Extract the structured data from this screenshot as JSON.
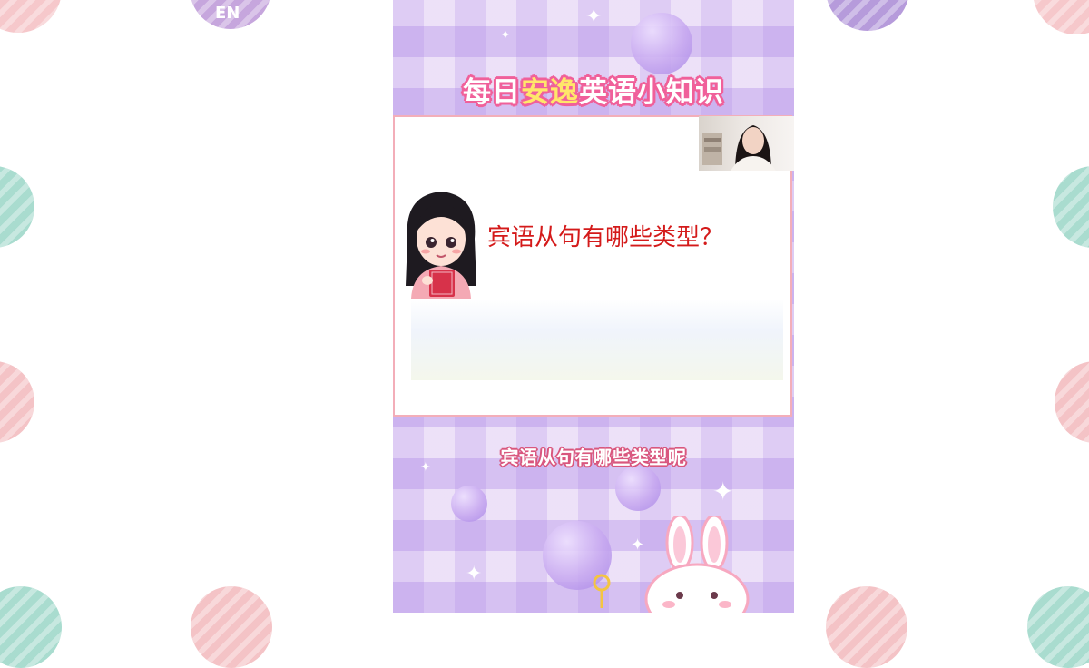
{
  "corner_badge": {
    "label": "EN"
  },
  "video": {
    "title_part1": "每日",
    "title_highlight": "安逸",
    "title_part2": "英语小知识",
    "slide_question": "宾语从句有哪些类型？",
    "caption": "宾语从句有哪些类型呢"
  },
  "colors": {
    "title_outline": "#f0609a",
    "title_highlight": "#ffe76a",
    "question_text": "#d41a1a",
    "card_border": "#f3aeb9",
    "phone_background": "#e6d6f6"
  },
  "icons": [
    "girl-with-book-illustration",
    "bunny-illustration",
    "sparkle-icon",
    "bubble-wand"
  ]
}
